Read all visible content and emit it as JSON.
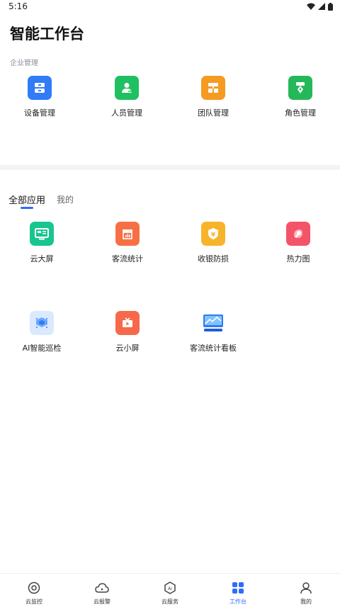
{
  "status_bar": {
    "time": "5:16"
  },
  "page": {
    "title": "智能工作台"
  },
  "enterprise": {
    "section_label": "企业管理",
    "items": [
      {
        "label": "设备管理",
        "icon": "device-icon",
        "color": "#2f7cf6"
      },
      {
        "label": "人员管理",
        "icon": "person-icon",
        "color": "#20c062"
      },
      {
        "label": "团队管理",
        "icon": "team-icon",
        "color": "#f59b22"
      },
      {
        "label": "角色管理",
        "icon": "role-icon",
        "color": "#25b85a"
      }
    ]
  },
  "tabs": [
    {
      "label": "全部应用",
      "active": true
    },
    {
      "label": "我的",
      "active": false
    }
  ],
  "apps": {
    "row1": [
      {
        "label": "云大屏",
        "icon": "big-screen-icon",
        "color": "#19c58e"
      },
      {
        "label": "客流统计",
        "icon": "store-stats-icon",
        "color": "#f77045"
      },
      {
        "label": "收银防损",
        "icon": "cashier-icon",
        "color": "#f7b42a"
      },
      {
        "label": "热力图",
        "icon": "heatmap-icon",
        "color": "#f45468"
      }
    ],
    "row2": [
      {
        "label": "AI智能巡检",
        "icon": "ai-inspection-icon",
        "color": "#6aa7ff"
      },
      {
        "label": "云小屏",
        "icon": "small-screen-icon",
        "color": "#f7694a"
      },
      {
        "label": "客流统计看板",
        "icon": "dashboard-icon",
        "color": "#2f7cf6"
      }
    ]
  },
  "bottom_nav": [
    {
      "label": "云监控",
      "icon": "monitor-icon",
      "active": false
    },
    {
      "label": "云报警",
      "icon": "cloud-alarm-icon",
      "active": false
    },
    {
      "label": "云服务",
      "icon": "ai-service-icon",
      "active": false
    },
    {
      "label": "工作台",
      "icon": "workbench-icon",
      "active": true
    },
    {
      "label": "我的",
      "icon": "profile-icon",
      "active": false
    }
  ],
  "accent_color": "#2f6bff"
}
